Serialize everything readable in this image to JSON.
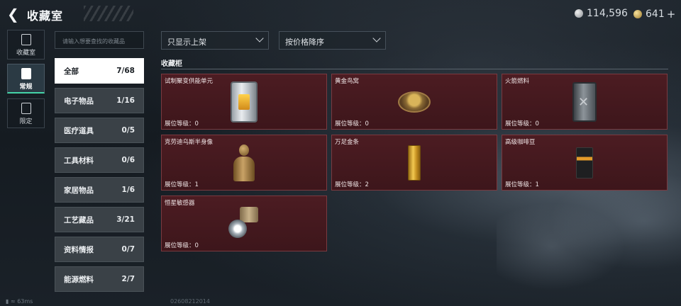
{
  "header": {
    "title": "收藏室",
    "currency_silver": "114,596",
    "currency_gold": "641",
    "plus": "+"
  },
  "sidenav": [
    {
      "label": "收藏室"
    },
    {
      "label": "常规"
    },
    {
      "label": "限定"
    }
  ],
  "search": {
    "placeholder": "请输入想要查找的收藏品"
  },
  "categories": [
    {
      "label": "全部",
      "count": "7/68"
    },
    {
      "label": "电子物品",
      "count": "1/16"
    },
    {
      "label": "医疗道具",
      "count": "0/5"
    },
    {
      "label": "工具材料",
      "count": "0/6"
    },
    {
      "label": "家居物品",
      "count": "1/6"
    },
    {
      "label": "工艺藏品",
      "count": "3/21"
    },
    {
      "label": "资料情报",
      "count": "0/7"
    },
    {
      "label": "能源燃料",
      "count": "2/7"
    }
  ],
  "filters": {
    "display": "只显示上架",
    "sort": "按价格降序"
  },
  "section_title": "收藏柜",
  "items": [
    {
      "name": "试制聚变供能单元",
      "level": "展位等级：0"
    },
    {
      "name": "黄金鸟窝",
      "level": "展位等级：0"
    },
    {
      "name": "火箭燃料",
      "level": "展位等级：0"
    },
    {
      "name": "克劳迪乌斯半身像",
      "level": "展位等级：1"
    },
    {
      "name": "万足金条",
      "level": "展位等级：2"
    },
    {
      "name": "高级咖啡豆",
      "level": "展位等级：1"
    },
    {
      "name": "恒星敏感器",
      "level": "展位等级：0"
    }
  ],
  "footer": {
    "ping": "63ms",
    "uid": "02608212014"
  },
  "colors": {
    "card_bg": "#4c1c22",
    "active_tab_accent": "#44d3a8",
    "gold": "#f2c850"
  }
}
